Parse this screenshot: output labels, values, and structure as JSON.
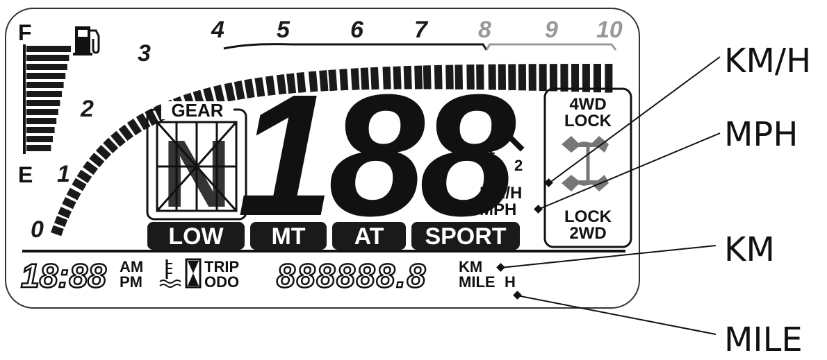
{
  "fuel": {
    "full_label": "F",
    "empty_label": "E",
    "icon": "fuel-pump-icon",
    "bars": 12
  },
  "tach": {
    "scale": [
      "0",
      "1",
      "2",
      "3",
      "4",
      "5",
      "6",
      "7",
      "8",
      "9",
      "10"
    ],
    "redline_from": 8,
    "segments": 60
  },
  "gear": {
    "title": "GEAR",
    "value": "N"
  },
  "speed": {
    "value": "188"
  },
  "service": {
    "one": "1",
    "two": "2",
    "icon": "wrench-icon"
  },
  "units": {
    "kmh": "KM/H",
    "mph": "MPH"
  },
  "drive_lock": {
    "top_a": "4WD",
    "top_b": "LOCK",
    "bottom_a": "LOCK",
    "bottom_b": "2WD",
    "icon": "drivetrain-icon"
  },
  "modes": [
    "LOW",
    "MT",
    "AT",
    "SPORT"
  ],
  "bottom": {
    "clock": "18:88",
    "am": "AM",
    "pm": "PM",
    "temp_icon": "coolant-temp-icon",
    "hourglass_icon": "hourglass-icon",
    "trip": "TRIP",
    "odo": "ODO",
    "odometer": "888888.8",
    "km": "KM",
    "mile": "MILE",
    "hour": "H"
  },
  "callouts": {
    "kmh": "KM/H",
    "mph": "MPH",
    "km": "KM",
    "mile": "MILE"
  },
  "colors": {
    "lcd": "#1a1a1a",
    "redline": "#999999",
    "frame": "#333333"
  }
}
